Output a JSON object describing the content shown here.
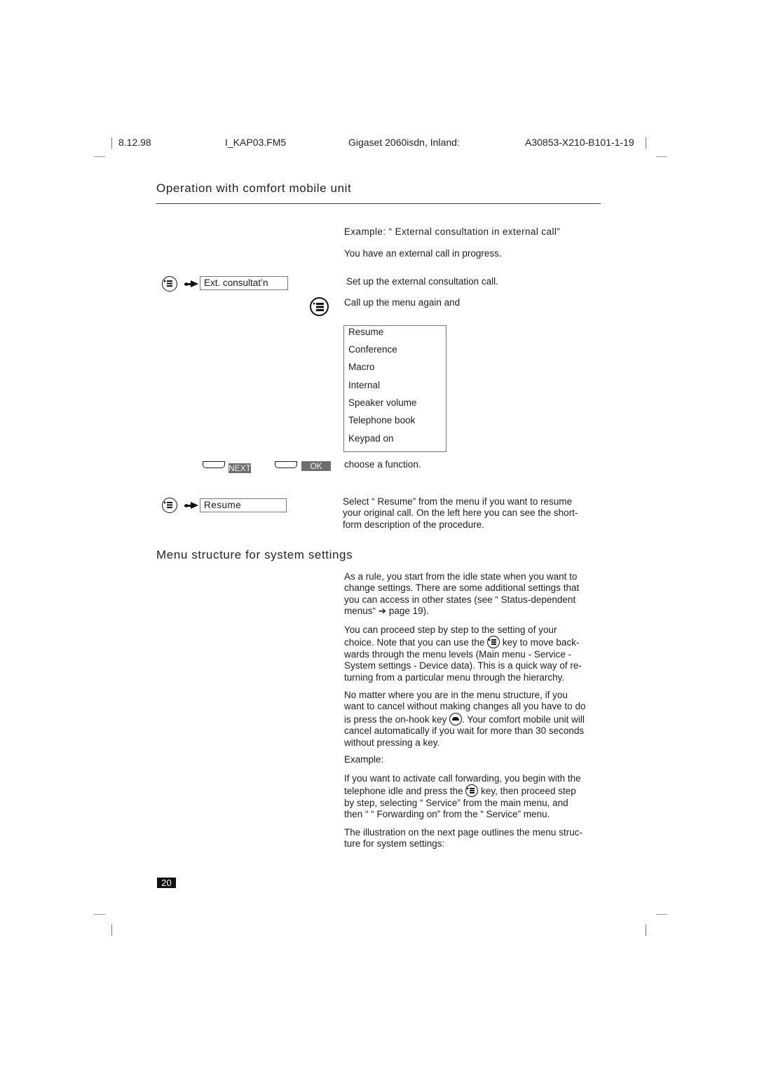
{
  "header": {
    "date": "8.12.98",
    "file": "I_KAP03.FM5",
    "product": "Gigaset 2060isdn, Inland:",
    "doc_number": "A30853-X210-B101-1-19"
  },
  "section1": {
    "title": "Operation with comfort mobile unit",
    "example_heading": "Example: “ External consultation in external call”",
    "intro": "You have an external call in progress.",
    "step1": {
      "display_text": "Ext. consultat’n",
      "description": "Set up the external consultation call."
    },
    "step2": {
      "description": "Call up the menu again and"
    },
    "menu_items": [
      "Resume",
      "Conference",
      "Macro",
      "Internal",
      "Speaker volume",
      "Telephone book",
      "Keypad on"
    ],
    "softkeys": {
      "next_label": "NEXT",
      "ok_label": "OK",
      "description": "choose a function."
    },
    "step3": {
      "display_text": "Resume",
      "description_lines": [
        "Select “ Resume”  from the menu if you want to resume",
        "your original call. On the left here you can see the short-",
        "form description of the procedure."
      ]
    }
  },
  "section2": {
    "title": "Menu structure for system settings",
    "para1_lines": [
      "As a rule, you start from the idle state when you want to",
      "change settings. There are some additional settings that",
      "you can access in other states (see “ Status-dependent",
      "menus“  ➔ page 19)."
    ],
    "para2": {
      "line1": "You can proceed step by step to the setting of your",
      "line2_before": "choice. Note that you can use the ",
      "line2_after": " key to move back-",
      "lines_rest": [
        "wards through the menu levels (Main menu - Service -",
        "System settings - Device data). This is a quick way of re-",
        "turning from a particular menu through the hierarchy."
      ]
    },
    "para3": {
      "line1": "No matter where you are in the menu structure, if you",
      "line2": "want to cancel without making changes all you have to do",
      "line3_before": "is press the on-hook key ",
      "line3_after": ". Your comfort mobile unit will",
      "lines_rest": [
        "cancel automatically if you wait for more than 30 seconds",
        "without pressing a key."
      ]
    },
    "example_label": "Example:",
    "para4": {
      "line1": "If you want to activate call forwarding, you begin with the",
      "line2_before": "telephone idle and press the ",
      "line2_after": " key, then proceed step",
      "lines_rest": [
        "by step, selecting “ Service”  from the main menu, and",
        "then “ “ Forwarding on”  from the “ Service”  menu."
      ]
    },
    "para5_lines": [
      "The illustration on the next page outlines the menu struc-",
      "ture for system settings:"
    ]
  },
  "footer": {
    "page_number": "20"
  }
}
